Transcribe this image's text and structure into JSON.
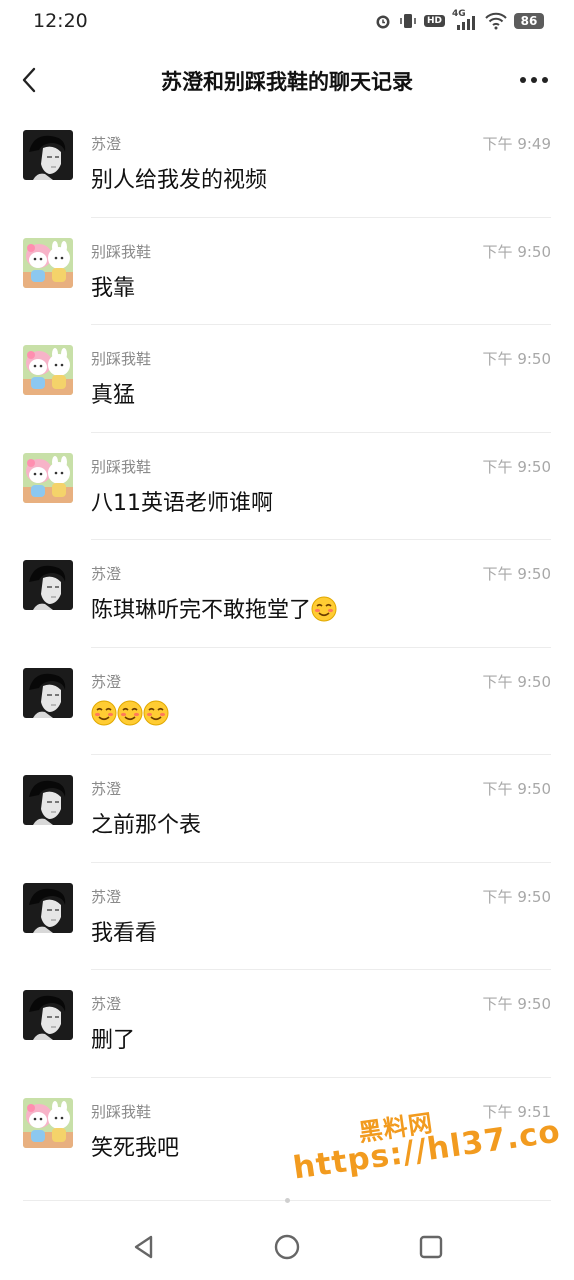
{
  "status_bar": {
    "time": "12:20",
    "network": "4G",
    "hd": "HD",
    "battery": "86"
  },
  "header": {
    "title": "苏澄和别踩我鞋的聊天记录"
  },
  "colors": {
    "accent_watermark": "#f29b1f",
    "sender_text": "#8a8a8a",
    "time_text": "#a8a8a8"
  },
  "messages": [
    {
      "sender": "苏澄",
      "time": "下午 9:49",
      "text": "别人给我发的视频",
      "avatar": "suCheng",
      "emojis": 0
    },
    {
      "sender": "别踩我鞋",
      "time": "下午 9:50",
      "text": "我靠",
      "avatar": "bieCai",
      "emojis": 0
    },
    {
      "sender": "别踩我鞋",
      "time": "下午 9:50",
      "text": "真猛",
      "avatar": "bieCai",
      "emojis": 0
    },
    {
      "sender": "别踩我鞋",
      "time": "下午 9:50",
      "text": "八11英语老师谁啊",
      "avatar": "bieCai",
      "emojis": 0
    },
    {
      "sender": "苏澄",
      "time": "下午 9:50",
      "text": "陈琪琳听完不敢拖堂了",
      "avatar": "suCheng",
      "emojis": 1
    },
    {
      "sender": "苏澄",
      "time": "下午 9:50",
      "text": "",
      "avatar": "suCheng",
      "emojis": 3
    },
    {
      "sender": "苏澄",
      "time": "下午 9:50",
      "text": "之前那个表",
      "avatar": "suCheng",
      "emojis": 0
    },
    {
      "sender": "苏澄",
      "time": "下午 9:50",
      "text": "我看看",
      "avatar": "suCheng",
      "emojis": 0
    },
    {
      "sender": "苏澄",
      "time": "下午 9:50",
      "text": "删了",
      "avatar": "suCheng",
      "emojis": 0
    },
    {
      "sender": "别踩我鞋",
      "time": "下午 9:51",
      "text": "笑死我吧",
      "avatar": "bieCai",
      "emojis": 0
    }
  ],
  "watermark": {
    "line1": "黑料网",
    "line2": "https://hl37.co"
  }
}
